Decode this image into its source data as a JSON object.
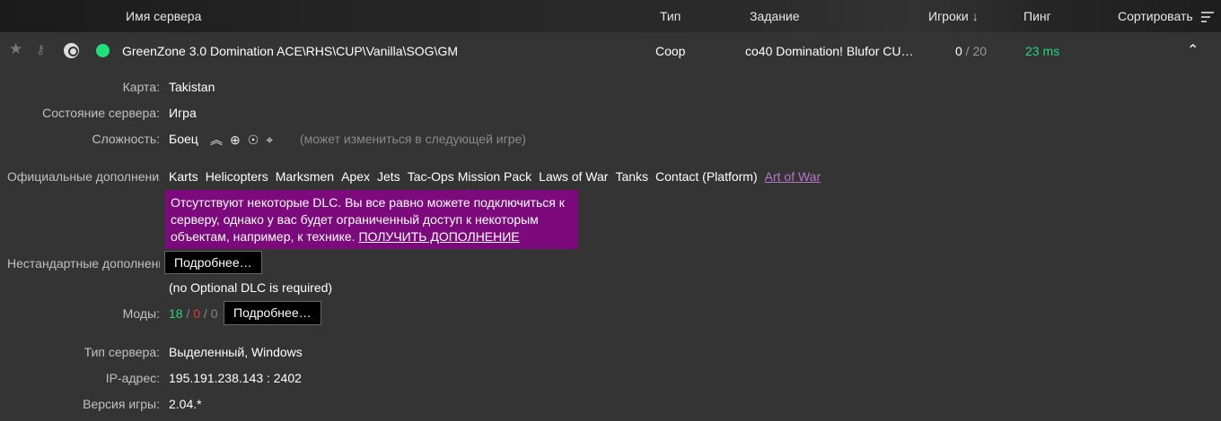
{
  "header": {
    "name": "Имя сервера",
    "type": "Тип",
    "mission": "Задание",
    "players": "Игроки",
    "players_sort_arrow": "↓",
    "ping": "Пинг",
    "sort": "Сортировать"
  },
  "server": {
    "name": "GreenZone 3.0 Domination ACE\\RHS\\CUP\\Vanilla\\SOG\\GM",
    "type": "Coop",
    "mission": "co40 Domination! Blufor CU…",
    "players_current": "0",
    "players_sep": " / ",
    "players_max": "20",
    "ping": "23 ms",
    "status_color": "#1fe07a"
  },
  "details": {
    "map_label": "Карта:",
    "map": "Takistan",
    "state_label": "Состояние сервера:",
    "state": "Игра",
    "difficulty_label": "Сложность:",
    "difficulty": "Боец",
    "difficulty_icons": [
      "rank-chevrons-icon",
      "mouse-aim-icon",
      "third-person-icon",
      "crosshair-icon"
    ],
    "difficulty_note": "(может измениться в следующей игре)",
    "official_dlc_label": "Официальные дополнения:",
    "official_dlc": [
      "Karts",
      "Helicopters",
      "Marksmen",
      "Apex",
      "Jets",
      "Tac-Ops Mission Pack",
      "Laws of War",
      "Tanks",
      "Contact (Platform)"
    ],
    "missing_dlc": "Art of War",
    "warning_text": "Отсутствуют некоторые DLC. Вы все равно можете подключиться к серверу, однако у вас будет ограниченный доступ к некоторым объектам, например, к технике.",
    "warning_link": "ПОЛУЧИТЬ ДОПОЛНЕНИЕ",
    "warning_color": "#7d0a7d",
    "nonstandard_dlc_label": "Нестандартные дополнения:",
    "more_button": "Подробнее…",
    "optional_dlc_note": "(no Optional DLC is required)",
    "mods_label": "Моды:",
    "mods_ok": "18",
    "mods_missing": "0",
    "mods_other": "0",
    "mods_sep": " / ",
    "mods_more_button": "Подробнее…",
    "server_type_label": "Тип сервера:",
    "server_type": "Выделенный, Windows",
    "ip_label": "IP-адрес:",
    "ip": "195.191.238.143 : 2402",
    "version_label": "Версия игры:",
    "version": "2.04.*"
  }
}
